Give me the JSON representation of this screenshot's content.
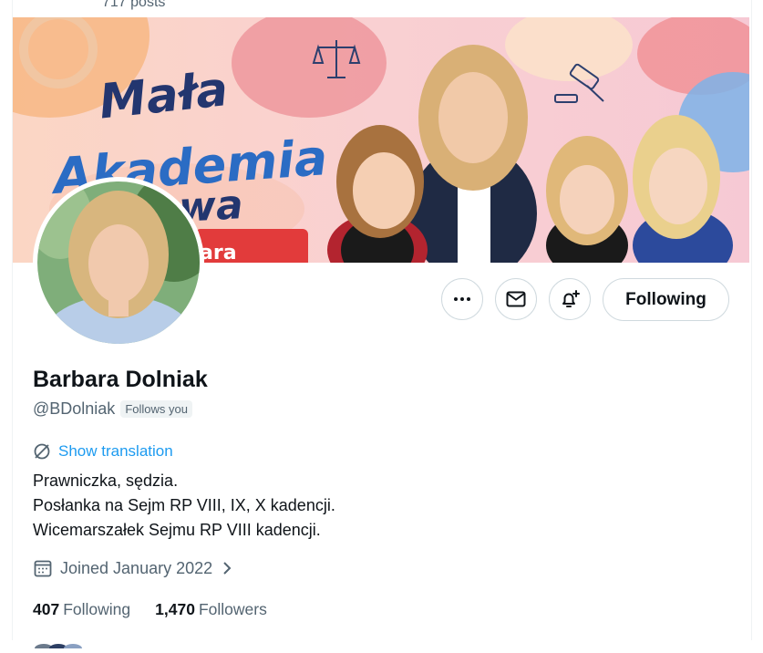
{
  "header": {
    "posts_count": "717 posts"
  },
  "banner": {
    "title_lines": [
      "Mała",
      "Akademia",
      "Prawa"
    ],
    "badge_text": "ara"
  },
  "actions": {
    "more_icon": "more-horizontal-icon",
    "message_icon": "envelope-icon",
    "notify_icon": "bell-plus-icon",
    "follow_label": "Following"
  },
  "profile": {
    "name": "Barbara Dolniak",
    "handle": "@BDolniak",
    "follows_you": "Follows you",
    "show_translation": "Show translation",
    "bio": [
      "Prawniczka, sędzia.",
      "Posłanka na Sejm RP VIII, IX, X kadencji.",
      "Wicemarszałek Sejmu RP VIII kadencji."
    ],
    "joined": "Joined January 2022"
  },
  "stats": {
    "following_count": "407",
    "following_label": "Following",
    "followers_count": "1,470",
    "followers_label": "Followers"
  },
  "colors": {
    "accent": "#1d9bf0",
    "text": "#0f1419",
    "muted": "#536471",
    "border": "#cfd9de"
  }
}
